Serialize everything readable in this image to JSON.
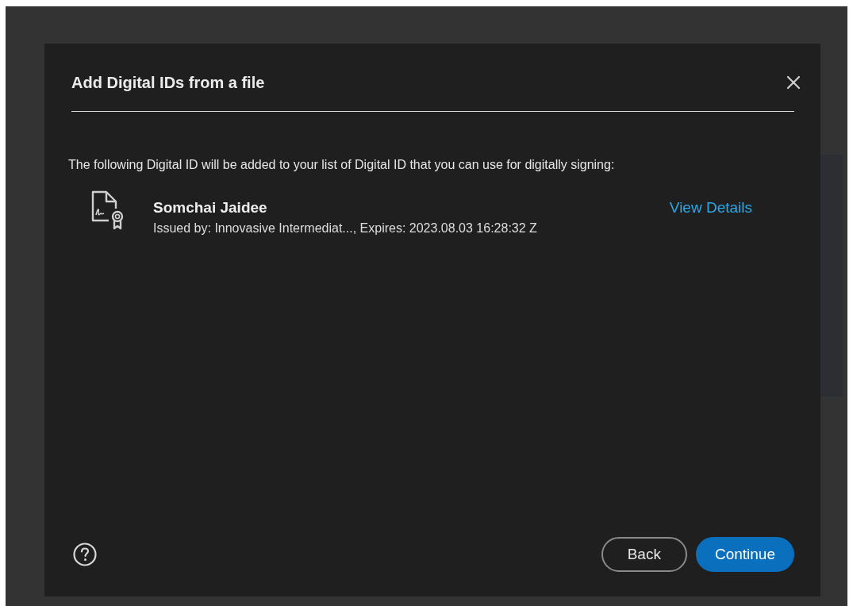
{
  "dialog": {
    "title": "Add Digital IDs from a file",
    "message": "The following Digital ID will be added to your list of Digital ID that you can use for digitally signing:",
    "digital_ids": [
      {
        "name": "Somchai Jaidee",
        "details": "Issued by: Innovasive Intermediat..., Expires: 2023.08.03 16:28:32 Z",
        "link": "View Details"
      }
    ],
    "buttons": [
      {
        "label": "Back",
        "kind": "secondary"
      },
      {
        "label": "Continue",
        "kind": "primary"
      }
    ]
  }
}
